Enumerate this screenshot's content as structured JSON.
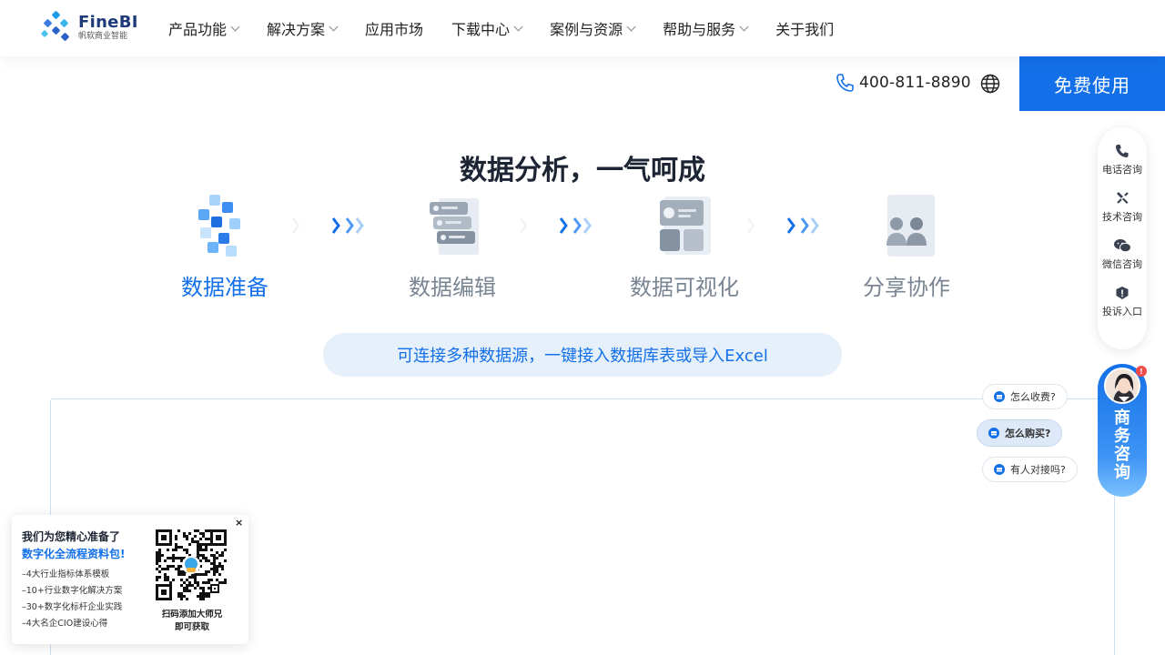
{
  "header": {
    "logo_name": "FineBI",
    "logo_sub": "帆软商业智能",
    "nav": [
      {
        "label": "产品功能",
        "dropdown": true
      },
      {
        "label": "解决方案",
        "dropdown": true
      },
      {
        "label": "应用市场",
        "dropdown": false
      },
      {
        "label": "下载中心",
        "dropdown": true
      },
      {
        "label": "案例与资源",
        "dropdown": true
      },
      {
        "label": "帮助与服务",
        "dropdown": true
      },
      {
        "label": "关于我们",
        "dropdown": false
      }
    ],
    "phone": "400-811-8890",
    "free_button": "免费使用"
  },
  "hero": {
    "title": "数据分析，一气呵成",
    "steps": [
      {
        "label": "数据准备",
        "active": true
      },
      {
        "label": "数据编辑",
        "active": false
      },
      {
        "label": "数据可视化",
        "active": false
      },
      {
        "label": "分享协作",
        "active": false
      }
    ],
    "description": "可连接多种数据源，一键接入数据库表或导入Excel"
  },
  "side_tools": [
    {
      "label": "电话咨询",
      "icon": "phone-icon"
    },
    {
      "label": "技术咨询",
      "icon": "tools-icon"
    },
    {
      "label": "微信咨询",
      "icon": "wechat-icon"
    },
    {
      "label": "投诉入口",
      "icon": "complaint-icon"
    }
  ],
  "quick_questions": [
    "怎么收费?",
    "怎么购买?",
    "有人对接吗?"
  ],
  "consult": {
    "text": "商务咨询",
    "badge": "!"
  },
  "promo": {
    "close": "×",
    "line1": "我们为您精心准备了",
    "line2": "数字化全流程资料包!",
    "items": [
      "–4大行业指标体系模板",
      "–10+行业数字化解决方案",
      "–30+数字化标杆企业实践",
      "–4大名企CIO建设心得"
    ],
    "qr_caption_1": "扫码添加大师兄",
    "qr_caption_2": "即可获取"
  },
  "colors": {
    "accent": "#1370e8",
    "title": "#1d2433",
    "inactive": "#7a8593",
    "pill_bg": "#e6f0fb"
  }
}
